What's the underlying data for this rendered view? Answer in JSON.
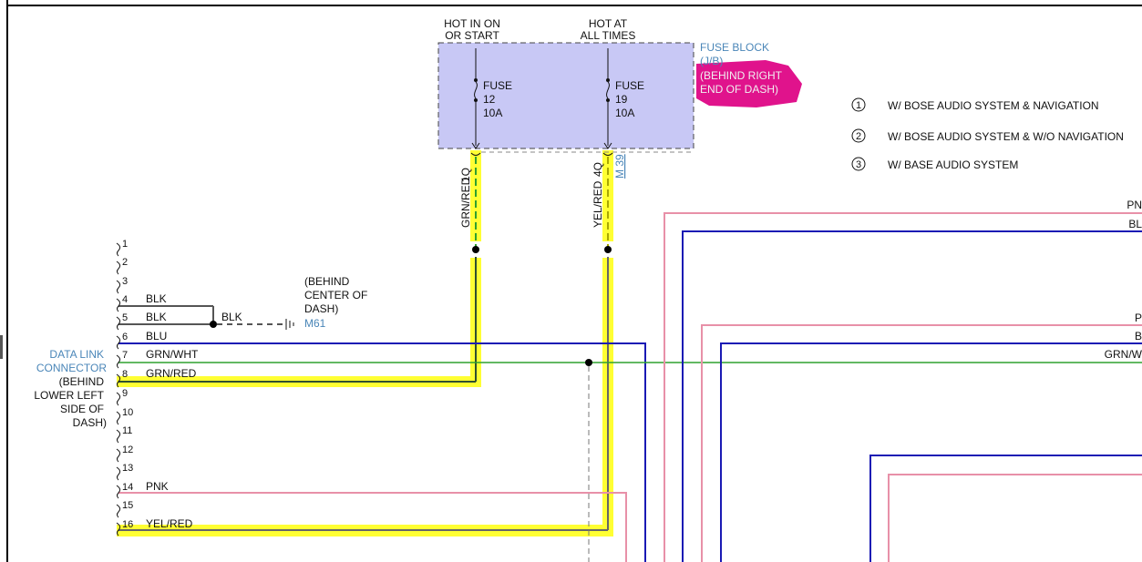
{
  "power": {
    "hot_run_1": "HOT IN ON",
    "hot_run_2": "OR START",
    "hot_all_1": "HOT AT",
    "hot_all_2": "ALL TIMES"
  },
  "fuse_block": {
    "title": "FUSE BLOCK",
    "sub": "(J/B)",
    "loc1": "(BEHIND RIGHT",
    "loc2": "END OF DASH)",
    "fuse12": {
      "label": "FUSE",
      "num": "12",
      "amp": "10A",
      "pin": "1Q"
    },
    "fuse19": {
      "label": "FUSE",
      "num": "19",
      "amp": "10A",
      "pin": "4Q"
    }
  },
  "wires": {
    "grn_red": "GRN/RED",
    "yel_red": "YEL/RED",
    "m39": "M 39",
    "blk": "BLK"
  },
  "legend": [
    {
      "num": "1",
      "text": "W/ BOSE AUDIO SYSTEM & NAVIGATION"
    },
    {
      "num": "2",
      "text": "W/ BOSE AUDIO SYSTEM & W/O NAVIGATION"
    },
    {
      "num": "3",
      "text": "W/ BASE AUDIO SYSTEM"
    }
  ],
  "ground": {
    "loc1": "(BEHIND",
    "loc2": "CENTER OF",
    "loc3": "DASH)",
    "id": "M61"
  },
  "dlc": {
    "name1": "DATA LINK",
    "name2": "CONNECTOR",
    "loc1": "(BEHIND",
    "loc2": "LOWER LEFT",
    "loc3": "SIDE OF",
    "loc4": "DASH)"
  },
  "pins": [
    {
      "n": "1",
      "w": ""
    },
    {
      "n": "2",
      "w": ""
    },
    {
      "n": "3",
      "w": ""
    },
    {
      "n": "4",
      "w": "BLK"
    },
    {
      "n": "5",
      "w": "BLK"
    },
    {
      "n": "6",
      "w": "BLU"
    },
    {
      "n": "7",
      "w": "GRN/WHT"
    },
    {
      "n": "8",
      "w": "GRN/RED"
    },
    {
      "n": "9",
      "w": ""
    },
    {
      "n": "10",
      "w": ""
    },
    {
      "n": "11",
      "w": ""
    },
    {
      "n": "12",
      "w": ""
    },
    {
      "n": "13",
      "w": ""
    },
    {
      "n": "14",
      "w": "PNK"
    },
    {
      "n": "15",
      "w": ""
    },
    {
      "n": "16",
      "w": "YEL/RED"
    }
  ],
  "edge_labels": {
    "pnk": "PN",
    "blu": "BL",
    "p": "P",
    "b": "B",
    "grnw": "GRN/W"
  },
  "colors": {
    "highlight": "#ffff33",
    "fuse_block_fill": "#c8c8f5",
    "label_blue": "#4a86b8",
    "wire_blue": "#1a1ab4",
    "wire_pink": "#e890a8",
    "wire_green": "#2ea02e",
    "marker_magenta": "#e0138c"
  }
}
